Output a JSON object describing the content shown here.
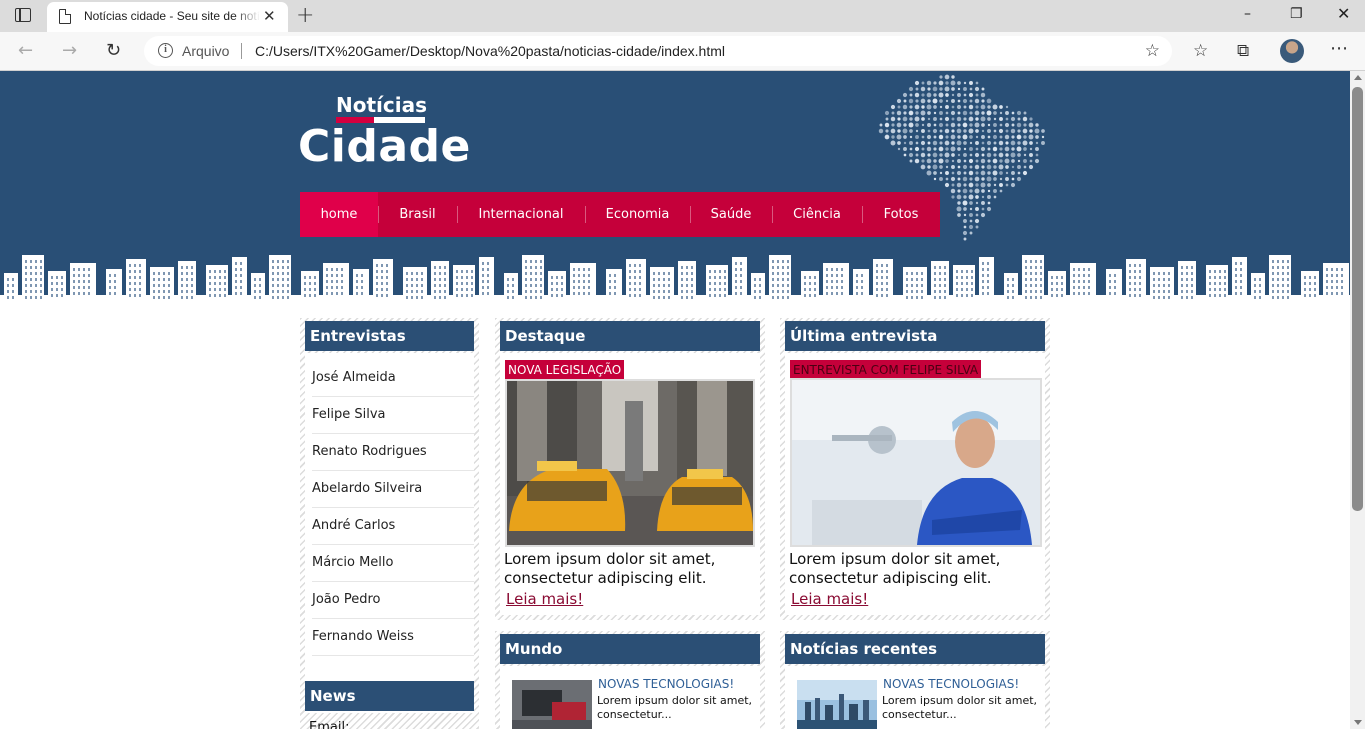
{
  "browser": {
    "tab_title": "Notícias cidade - Seu site de notícias",
    "tab_close": "✕",
    "new_tab": "+",
    "protocol_label": "Arquivo",
    "url": "C:/Users/ITX%20Gamer/Desktop/Nova%20pasta/noticias-cidade/index.html",
    "icons": [
      "sidebar-icon",
      "page-icon",
      "back-icon",
      "forward-icon",
      "refresh-icon",
      "info-icon",
      "add-favorite-icon",
      "favorites-icon",
      "collections-icon",
      "profile-avatar",
      "more-icon",
      "minimize-icon",
      "maximize-icon",
      "close-icon"
    ]
  },
  "site": {
    "logo_top": "Notícias",
    "logo_main": "Cidade",
    "menu": [
      {
        "label": "home",
        "active": true
      },
      {
        "label": "Brasil"
      },
      {
        "label": "Internacional"
      },
      {
        "label": "Economia"
      },
      {
        "label": "Saúde"
      },
      {
        "label": "Ciência"
      },
      {
        "label": "Fotos"
      }
    ],
    "colors": {
      "header": "#294f76",
      "menu": "#c5003a",
      "menu_active": "#e0004a",
      "box_title": "#2b4f75"
    }
  },
  "sidebar": {
    "title": "Entrevistas",
    "items": [
      "José Almeida",
      "Felipe Silva",
      "Renato Rodrigues",
      "Abelardo Silveira",
      "André Carlos",
      "Márcio Mello",
      "João Pedro",
      "Fernando Weiss"
    ],
    "news_title": "News",
    "news_email_label": "Email:"
  },
  "destaque": {
    "title": "Destaque",
    "tag": "NOVA LEGISLAÇÃO",
    "text": "Lorem ipsum dolor sit amet, consectetur adipiscing elit.",
    "link": "Leia mais!"
  },
  "entrevista": {
    "title": "Última entrevista",
    "tag": "ENTREVISTA COM FELIPE SILVA",
    "text": "Lorem ipsum dolor sit amet, consectetur adipiscing elit.",
    "link": "Leia mais!"
  },
  "mundo": {
    "title": "Mundo",
    "headline": "NOVAS TECNOLOGIAS!",
    "text": "Lorem ipsum dolor sit amet, consectetur..."
  },
  "recentes": {
    "title": "Notícias recentes",
    "headline": "NOVAS TECNOLOGIAS!",
    "text": "Lorem ipsum dolor sit amet, consectetur..."
  }
}
